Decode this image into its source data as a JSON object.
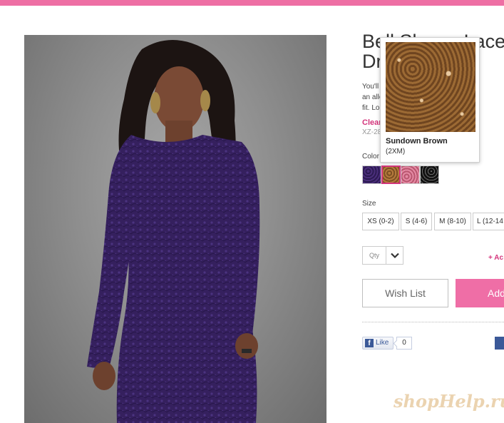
{
  "brand": {
    "accent": "#ee6fa4",
    "clearance_color": "#d4357c"
  },
  "product": {
    "title_line1": "Bell Sleeve Lace",
    "title_line2": "Dr",
    "description_lines": [
      "You'll                                  . This m",
      "an allo                                   very cu",
      "fit. Lo"
    ],
    "clearance_label": "Clear",
    "sku": "XZ-28"
  },
  "color": {
    "label": "Color",
    "swatches": [
      {
        "name": "purple",
        "hex": "#3b2366"
      },
      {
        "name": "Sundown Brown",
        "hex": "#8a5a2b",
        "selected": true
      },
      {
        "name": "pink",
        "hex": "#c96683"
      },
      {
        "name": "black",
        "hex": "#1a1a1a"
      }
    ],
    "popover": {
      "name": "Sundown Brown",
      "size": "(2XM)"
    }
  },
  "size": {
    "label": "Size",
    "options": [
      "XS (0-2)",
      "S (4-6)",
      "M (8-10)",
      "L (12-14"
    ]
  },
  "quantity": {
    "placeholder": "Qty",
    "icon": "chevron-down-icon"
  },
  "add_link": "+ Ac",
  "actions": {
    "wish_list": "Wish List",
    "add_to_bag": "Add"
  },
  "social": {
    "like_label": "Like",
    "like_count": "0",
    "icon": "facebook-icon"
  },
  "watermark": "shopHelp.ru"
}
